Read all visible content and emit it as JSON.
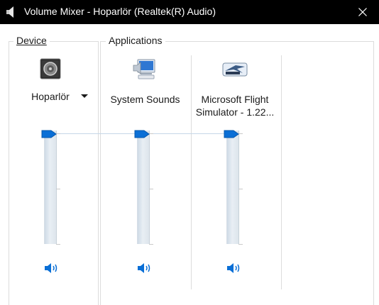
{
  "window": {
    "title": "Volume Mixer - Hoparlör (Realtek(R) Audio)",
    "accent": "#0a6fd6"
  },
  "device": {
    "group_label": "Device",
    "icon": "speaker-device-icon",
    "name": "Hoparlör",
    "volume_percent": 100
  },
  "applications": {
    "group_label": "Applications",
    "items": [
      {
        "name": "System Sounds",
        "icon": "system-sounds-icon",
        "volume_percent": 100
      },
      {
        "name_line1": "Microsoft Flight",
        "name_line2": "Simulator - 1.22...",
        "icon": "flight-simulator-icon",
        "volume_percent": 100
      }
    ]
  }
}
